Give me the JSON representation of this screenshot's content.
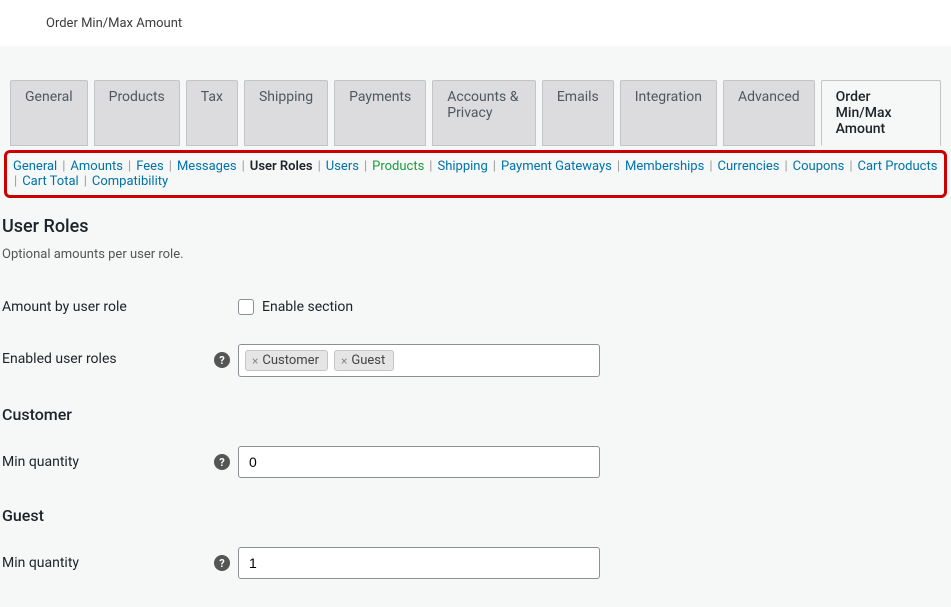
{
  "header": {
    "title": "Order Min/Max Amount"
  },
  "tabs": {
    "items": [
      {
        "label": "General"
      },
      {
        "label": "Products"
      },
      {
        "label": "Tax"
      },
      {
        "label": "Shipping"
      },
      {
        "label": "Payments"
      },
      {
        "label": "Accounts & Privacy"
      },
      {
        "label": "Emails"
      },
      {
        "label": "Integration"
      },
      {
        "label": "Advanced"
      },
      {
        "label": "Order Min/Max Amount",
        "active": true
      }
    ]
  },
  "subnav": {
    "items": [
      {
        "label": "General"
      },
      {
        "label": "Amounts"
      },
      {
        "label": "Fees"
      },
      {
        "label": "Messages"
      },
      {
        "label": "User Roles",
        "current": true
      },
      {
        "label": "Users"
      },
      {
        "label": "Products",
        "products": true
      },
      {
        "label": "Shipping"
      },
      {
        "label": "Payment Gateways"
      },
      {
        "label": "Memberships"
      },
      {
        "label": "Currencies"
      },
      {
        "label": "Coupons"
      },
      {
        "label": "Cart Products"
      },
      {
        "label": "Cart Total"
      },
      {
        "label": "Compatibility"
      }
    ]
  },
  "section": {
    "heading": "User Roles",
    "description": "Optional amounts per user role."
  },
  "fields": {
    "amount_by_role": {
      "label": "Amount by user role",
      "checkbox_label": "Enable section"
    },
    "enabled_roles": {
      "label": "Enabled user roles",
      "chips": [
        "Customer",
        "Guest"
      ]
    },
    "customer": {
      "heading": "Customer"
    },
    "customer_min_qty": {
      "label": "Min quantity",
      "value": "0"
    },
    "guest": {
      "heading": "Guest"
    },
    "guest_min_qty": {
      "label": "Min quantity",
      "value": "1"
    }
  }
}
